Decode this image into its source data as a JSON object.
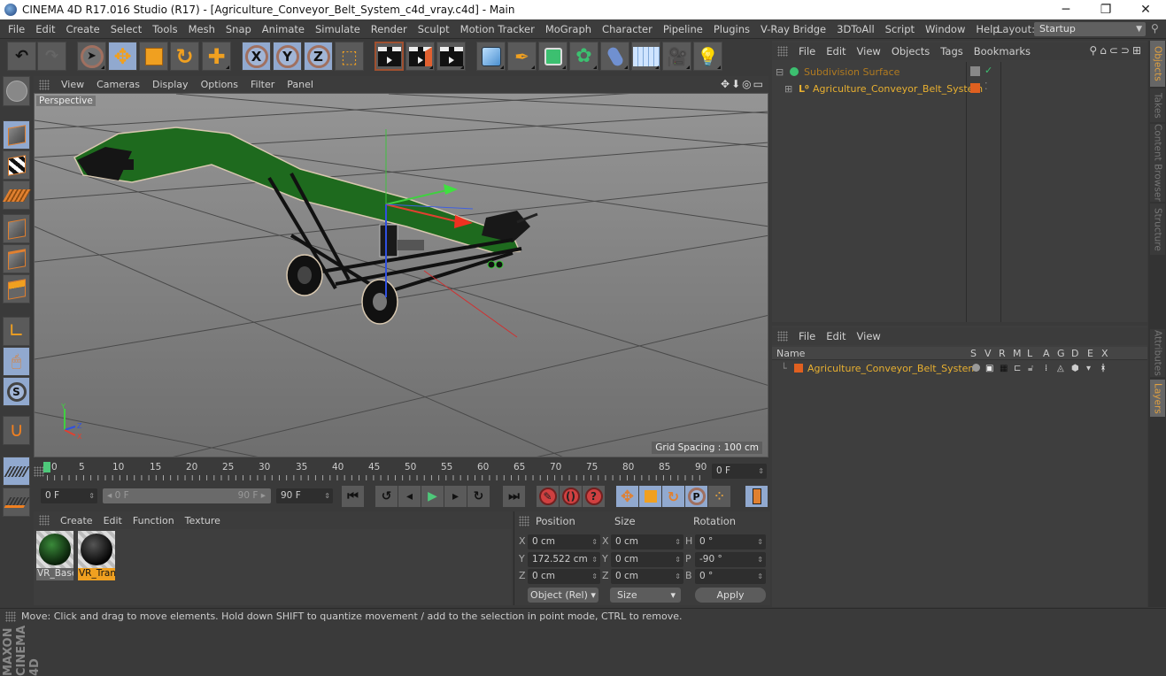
{
  "window": {
    "title": "CINEMA 4D R17.016 Studio (R17) - [Agriculture_Conveyor_Belt_System_c4d_vray.c4d] - Main",
    "controls": [
      "minimize",
      "restore",
      "close"
    ]
  },
  "menubar": {
    "items": [
      "File",
      "Edit",
      "Create",
      "Select",
      "Tools",
      "Mesh",
      "Snap",
      "Animate",
      "Simulate",
      "Render",
      "Sculpt",
      "Motion Tracker",
      "MoGraph",
      "Character",
      "Pipeline",
      "Plugins",
      "V-Ray Bridge",
      "3DToAll",
      "Script",
      "Window",
      "Help"
    ],
    "layout_label": "Layout:",
    "layout_value": "Startup"
  },
  "toolbar": {
    "icons": [
      "undo-icon",
      "redo-icon",
      "live-selection-icon",
      "move-icon",
      "scale-icon",
      "rotate-icon",
      "recent-tool-icon",
      "x-axis-lock-icon",
      "y-axis-lock-icon",
      "z-axis-lock-icon",
      "coordinate-system-icon",
      "render-view-icon",
      "render-picture-viewer-icon",
      "render-settings-icon",
      "cube-icon",
      "pen-spline-icon",
      "subdivision-icon",
      "array-icon",
      "deformer-icon",
      "floor-icon",
      "camera-icon",
      "light-icon"
    ],
    "axis_labels": [
      "X",
      "Y",
      "Z"
    ]
  },
  "left_toolbar": {
    "icons": [
      "make-editable-icon",
      "model-mode-icon",
      "texture-mode-icon",
      "points-mode-icon",
      "edges-mode-icon",
      "polygons-mode-icon",
      "axis-mode-icon",
      "tweak-mode-icon",
      "snap-icon",
      "magnet-icon",
      "workplane-lock-icon",
      "workplane-icon"
    ]
  },
  "viewport": {
    "menu": [
      "View",
      "Cameras",
      "Display",
      "Options",
      "Filter",
      "Panel"
    ],
    "camera_label": "Perspective",
    "grid_spacing": "Grid Spacing : 100 cm"
  },
  "timeline": {
    "ticks": [
      "0",
      "5",
      "10",
      "15",
      "20",
      "25",
      "30",
      "35",
      "40",
      "45",
      "50",
      "55",
      "60",
      "65",
      "70",
      "75",
      "80",
      "85",
      "90"
    ],
    "current_frame": "0 F",
    "start_field": "0 F",
    "range_start": "0 F",
    "range_end": "90 F",
    "end_field": "90 F"
  },
  "playback": {
    "buttons": [
      "go-to-start",
      "previous-key",
      "previous-frame",
      "play",
      "next-frame",
      "next-key",
      "go-to-end",
      "record",
      "autokey",
      "keyframe-help",
      "move-key",
      "scale-key",
      "rotate-key",
      "param-key",
      "pla-key",
      "timeline-layout"
    ]
  },
  "materials": {
    "menu": [
      "Create",
      "Edit",
      "Function",
      "Texture"
    ],
    "items": [
      {
        "name": "VR_Base",
        "selected": false
      },
      {
        "name": "VR_Tran",
        "selected": true
      }
    ]
  },
  "coordinates": {
    "headers": {
      "position": "Position",
      "size": "Size",
      "rotation": "Rotation"
    },
    "position": {
      "x": "0 cm",
      "y": "172.522 cm",
      "z": "0 cm"
    },
    "size": {
      "x": "0 cm",
      "y": "0 cm",
      "z": "0 cm"
    },
    "rotation": {
      "h": "0 °",
      "p": "-90 °",
      "b": "0 °"
    },
    "axis_labels": {
      "x": "X",
      "y": "Y",
      "z": "Z",
      "h": "H",
      "p": "P",
      "b": "B"
    },
    "mode_select": "Object (Rel)",
    "size_select": "Size",
    "apply_label": "Apply"
  },
  "object_manager": {
    "menu": [
      "File",
      "Edit",
      "View",
      "Objects",
      "Tags",
      "Bookmarks"
    ],
    "objects": [
      {
        "name": "Subdivision Surface",
        "color": "#b07a20"
      },
      {
        "name": "Agriculture_Conveyor_Belt_System",
        "color": "#e8b030"
      }
    ]
  },
  "layer_manager": {
    "menu": [
      "File",
      "Edit",
      "View"
    ],
    "columns": [
      "Name",
      "S",
      "V",
      "R",
      "M",
      "L",
      "A",
      "G",
      "D",
      "E",
      "X"
    ],
    "layers": [
      {
        "name": "Agriculture_Conveyor_Belt_System",
        "color": "#e06020"
      }
    ]
  },
  "side_tabs": {
    "top": [
      "Objects",
      "Takes",
      "Content Browser",
      "Structure"
    ],
    "bottom": [
      "Attributes",
      "Layers"
    ]
  },
  "status_bar": {
    "text": "Move: Click and drag to move elements. Hold down SHIFT to quantize movement / add to the selection in point mode, CTRL to remove."
  },
  "branding": {
    "logo_text": "MAXON CINEMA 4D"
  },
  "colors": {
    "accent_blue": "#91a9cf",
    "selected_orange": "#f0a020",
    "play_green": "#4ec87a",
    "object_text": "#e8b030"
  }
}
